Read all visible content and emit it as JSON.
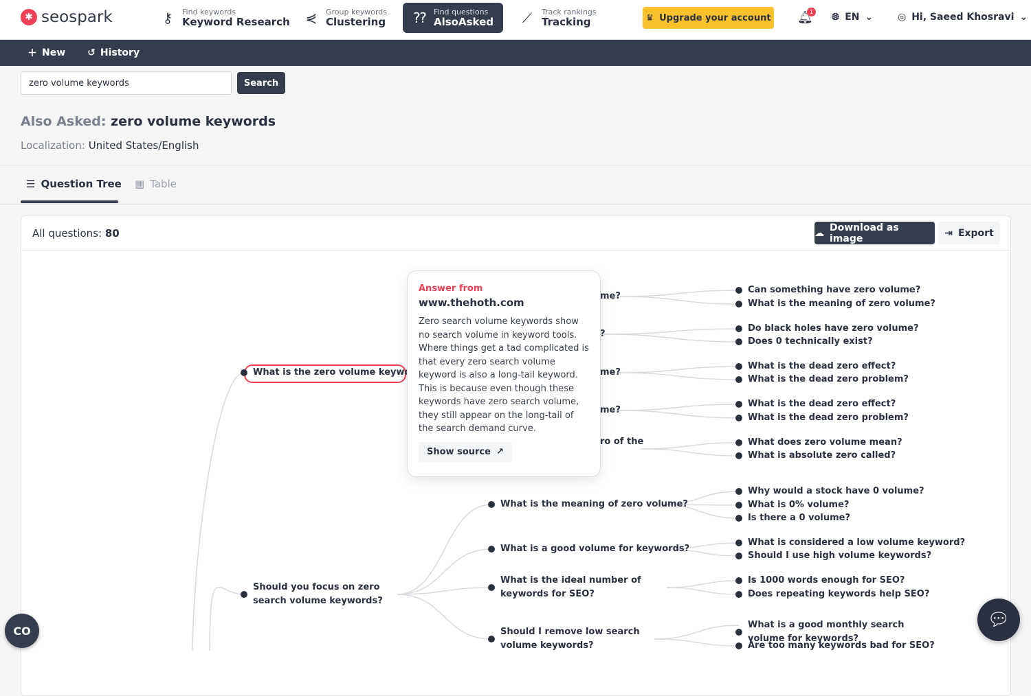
{
  "brand": {
    "name": "seospark",
    "accent": "#ef4056",
    "dark": "#353c4c",
    "upgrade_color": "#fcc22d"
  },
  "nav": [
    {
      "sub": "Find keywords",
      "label": "Keyword Research",
      "icon": "key-icon"
    },
    {
      "sub": "Group keywords",
      "label": "Clustering",
      "icon": "share-nodes-icon"
    },
    {
      "sub": "Find questions",
      "label": "AlsoAsked",
      "icon": "chat-question-icon",
      "active": true
    },
    {
      "sub": "Track rankings",
      "label": "Tracking",
      "icon": "line-chart-icon"
    }
  ],
  "upgrade": "Upgrade your account",
  "notifications": "1",
  "language": "EN",
  "user": "Hi, Saeed Khosravi",
  "subnav": {
    "new": "New",
    "history": "History"
  },
  "search": {
    "value": "zero volume keywords",
    "button": "Search"
  },
  "page": {
    "prefix": "Also Asked:",
    "query": "zero volume keywords",
    "loc_label": "Localization:",
    "loc_value": "United States/English"
  },
  "tabs": {
    "tree": "Question Tree",
    "table": "Table"
  },
  "card": {
    "count_label": "All questions:",
    "count": "80",
    "download": "Download as image",
    "export": "Export"
  },
  "tooltip": {
    "from": "Answer from",
    "domain": "www.thehoth.com",
    "body": "Zero search volume keywords show no search volume in keyword tools. Where things get a tad complicated is that every zero search volume keyword is also a long-tail keyword. This is because even though these keywords have zero search volume, they still appear on the long-tail of the search demand curve.",
    "source": "Show source"
  },
  "tree": {
    "level1": [
      "What is the zero volume keyword?",
      "Should you focus on zero search volume keywords?"
    ],
    "level2_hidden_fragments": [
      "me?",
      "?",
      "me?",
      "me?",
      "ro of the"
    ],
    "level2": [
      "What is the meaning of zero volume?",
      "What is a good volume for keywords?",
      "What is the ideal number of keywords for SEO?",
      "Should I remove low search volume keywords?"
    ],
    "level3": [
      [
        "Can something have zero volume?",
        "What is the meaning of zero volume?"
      ],
      [
        "Do black holes have zero volume?",
        "Does 0 technically exist?"
      ],
      [
        "What is the dead zero effect?",
        "What is the dead zero problem?"
      ],
      [
        "What is the dead zero effect?",
        "What is the dead zero problem?"
      ],
      [
        "What does zero volume mean?",
        "What is absolute zero called?"
      ],
      [
        "Why would a stock have 0 volume?",
        "What is 0% volume?",
        "Is there a 0 volume?"
      ],
      [
        "What is considered a low volume keyword?",
        "Should I use high volume keywords?"
      ],
      [
        "Is 1000 words enough for SEO?",
        "Does repeating keywords help SEO?"
      ],
      [
        "What is a good monthly search volume for keywords?",
        "Are too many keywords bad for SEO?"
      ]
    ]
  }
}
